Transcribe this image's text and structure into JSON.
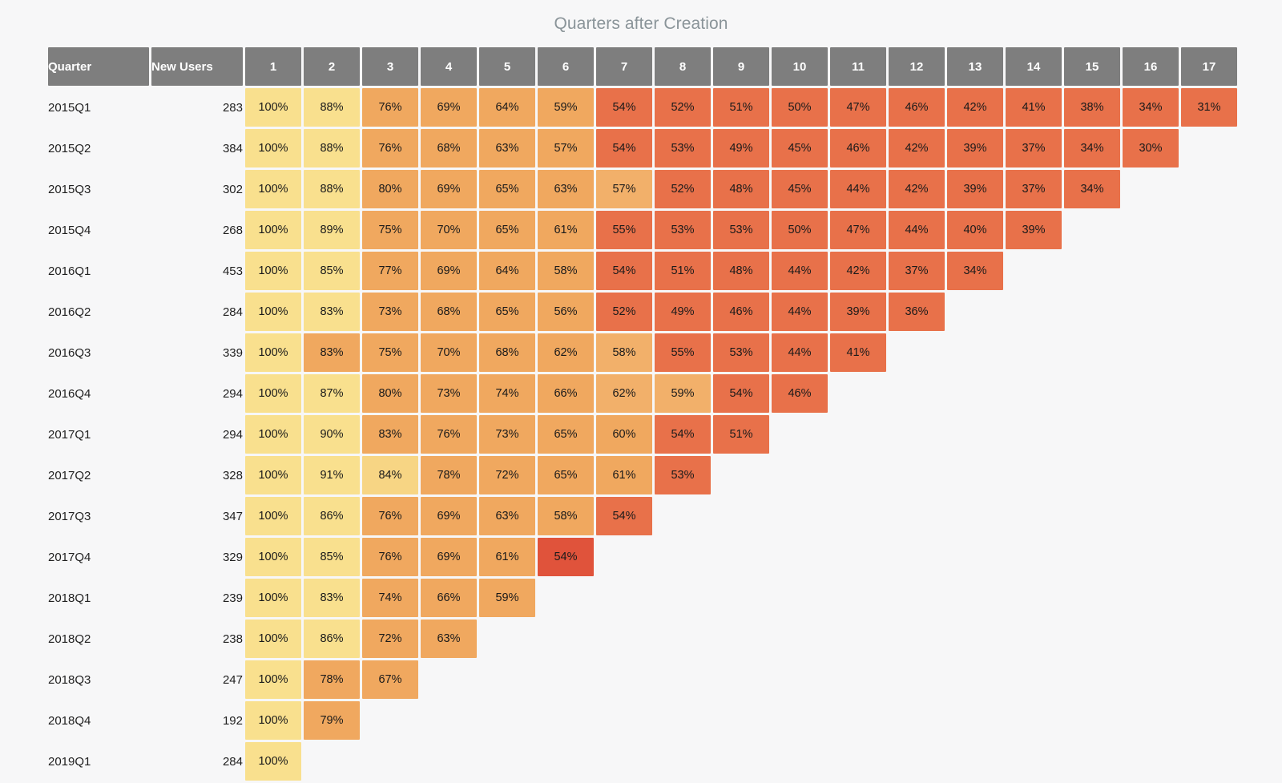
{
  "chart_data": {
    "type": "heatmap",
    "title": "Quarters after Creation",
    "xlabel": "",
    "ylabel": "",
    "row_header_labels": [
      "Quarter",
      "New Users"
    ],
    "categories": [
      "1",
      "2",
      "3",
      "4",
      "5",
      "6",
      "7",
      "8",
      "9",
      "10",
      "11",
      "12",
      "13",
      "14",
      "15",
      "16",
      "17"
    ],
    "grid": false,
    "legend": "none",
    "value_suffix": "%",
    "colorscale": {
      "name": "YlOrRd-binned",
      "bins": [
        {
          "max": 101,
          "color": "#f9e08e"
        },
        {
          "max": 93,
          "color": "#f9e08e"
        },
        {
          "max": 82,
          "color": "#f0a85f"
        },
        {
          "max": 56,
          "color": "#e8714a"
        },
        {
          "max": 0,
          "color": "#e05038"
        }
      ],
      "light": "#f9e08e",
      "mid": "#f0a85f",
      "dark": "#e8714a",
      "darkest": "#e0533b"
    },
    "header_bg": "#7e7e7e",
    "header_text": "#ffffff",
    "page_bg": "#f7f7f8",
    "title_color": "#8a9499",
    "rows": [
      {
        "quarter": "2015Q1",
        "new_users": "283",
        "values": [
          "100%",
          "88%",
          "76%",
          "69%",
          "64%",
          "59%",
          "54%",
          "52%",
          "51%",
          "50%",
          "47%",
          "46%",
          "42%",
          "41%",
          "38%",
          "34%",
          "31%"
        ],
        "colors": [
          "#f9e08e",
          "#f9e08e",
          "#f0a85f",
          "#f0a85f",
          "#f0a85f",
          "#f0a85f",
          "#e8714a",
          "#e8714a",
          "#e8714a",
          "#e8714a",
          "#e8714a",
          "#e8714a",
          "#e8714a",
          "#e8714a",
          "#e8714a",
          "#e8714a",
          "#e8714a"
        ]
      },
      {
        "quarter": "2015Q2",
        "new_users": "384",
        "values": [
          "100%",
          "88%",
          "76%",
          "68%",
          "63%",
          "57%",
          "54%",
          "53%",
          "49%",
          "45%",
          "46%",
          "42%",
          "39%",
          "37%",
          "34%",
          "30%"
        ],
        "colors": [
          "#f9e08e",
          "#f9e08e",
          "#f0a85f",
          "#f0a85f",
          "#f0a85f",
          "#f0a85f",
          "#e8714a",
          "#e8714a",
          "#e8714a",
          "#e8714a",
          "#e8714a",
          "#e8714a",
          "#e8714a",
          "#e8714a",
          "#e8714a",
          "#e8714a"
        ]
      },
      {
        "quarter": "2015Q3",
        "new_users": "302",
        "values": [
          "100%",
          "88%",
          "80%",
          "69%",
          "65%",
          "63%",
          "57%",
          "52%",
          "48%",
          "45%",
          "44%",
          "42%",
          "39%",
          "37%",
          "34%"
        ],
        "colors": [
          "#f9e08e",
          "#f9e08e",
          "#f0a85f",
          "#f0a85f",
          "#f0a85f",
          "#f0a85f",
          "#f2b06a",
          "#e8714a",
          "#e8714a",
          "#e8714a",
          "#e8714a",
          "#e8714a",
          "#e8714a",
          "#e8714a",
          "#e8714a"
        ]
      },
      {
        "quarter": "2015Q4",
        "new_users": "268",
        "values": [
          "100%",
          "89%",
          "75%",
          "70%",
          "65%",
          "61%",
          "55%",
          "53%",
          "53%",
          "50%",
          "47%",
          "44%",
          "40%",
          "39%"
        ],
        "colors": [
          "#f9e08e",
          "#f9e08e",
          "#f0a85f",
          "#f0a85f",
          "#f0a85f",
          "#f0a85f",
          "#e8714a",
          "#e8714a",
          "#e8714a",
          "#e8714a",
          "#e8714a",
          "#e8714a",
          "#e8714a",
          "#e8714a"
        ]
      },
      {
        "quarter": "2016Q1",
        "new_users": "453",
        "values": [
          "100%",
          "85%",
          "77%",
          "69%",
          "64%",
          "58%",
          "54%",
          "51%",
          "48%",
          "44%",
          "42%",
          "37%",
          "34%"
        ],
        "colors": [
          "#f9e08e",
          "#f9e08e",
          "#f0a85f",
          "#f0a85f",
          "#f0a85f",
          "#f0a85f",
          "#e8714a",
          "#e8714a",
          "#e8714a",
          "#e8714a",
          "#e8714a",
          "#e8714a",
          "#e8714a"
        ]
      },
      {
        "quarter": "2016Q2",
        "new_users": "284",
        "values": [
          "100%",
          "83%",
          "73%",
          "68%",
          "65%",
          "56%",
          "52%",
          "49%",
          "46%",
          "44%",
          "39%",
          "36%"
        ],
        "colors": [
          "#f9e08e",
          "#f9e08e",
          "#f0a85f",
          "#f0a85f",
          "#f0a85f",
          "#f0a85f",
          "#e8714a",
          "#e8714a",
          "#e8714a",
          "#e8714a",
          "#e8714a",
          "#e8714a"
        ]
      },
      {
        "quarter": "2016Q3",
        "new_users": "339",
        "values": [
          "100%",
          "83%",
          "75%",
          "70%",
          "68%",
          "62%",
          "58%",
          "55%",
          "53%",
          "44%",
          "41%"
        ],
        "colors": [
          "#f9e08e",
          "#f0a85f",
          "#f0a85f",
          "#f0a85f",
          "#f0a85f",
          "#f0a85f",
          "#f2b06a",
          "#e8714a",
          "#e8714a",
          "#e8714a",
          "#e8714a"
        ]
      },
      {
        "quarter": "2016Q4",
        "new_users": "294",
        "values": [
          "100%",
          "87%",
          "80%",
          "73%",
          "74%",
          "66%",
          "62%",
          "59%",
          "54%",
          "46%"
        ],
        "colors": [
          "#f9e08e",
          "#f9e08e",
          "#f0a85f",
          "#f0a85f",
          "#f0a85f",
          "#f0a85f",
          "#f2b06a",
          "#f2b06a",
          "#e8714a",
          "#e8714a"
        ]
      },
      {
        "quarter": "2017Q1",
        "new_users": "294",
        "values": [
          "100%",
          "90%",
          "83%",
          "76%",
          "73%",
          "65%",
          "60%",
          "54%",
          "51%"
        ],
        "colors": [
          "#f9e08e",
          "#f9e08e",
          "#f0a85f",
          "#f0a85f",
          "#f0a85f",
          "#f0a85f",
          "#f0a85f",
          "#e8714a",
          "#e8714a"
        ]
      },
      {
        "quarter": "2017Q2",
        "new_users": "328",
        "values": [
          "100%",
          "91%",
          "84%",
          "78%",
          "72%",
          "65%",
          "61%",
          "53%"
        ],
        "colors": [
          "#f9e08e",
          "#f9e08e",
          "#f7d584",
          "#f0a85f",
          "#f0a85f",
          "#f0a85f",
          "#f0a85f",
          "#e8714a"
        ]
      },
      {
        "quarter": "2017Q3",
        "new_users": "347",
        "values": [
          "100%",
          "86%",
          "76%",
          "69%",
          "63%",
          "58%",
          "54%"
        ],
        "colors": [
          "#f9e08e",
          "#f9e08e",
          "#f0a85f",
          "#f0a85f",
          "#f0a85f",
          "#f0a85f",
          "#e8714a"
        ]
      },
      {
        "quarter": "2017Q4",
        "new_users": "329",
        "values": [
          "100%",
          "85%",
          "76%",
          "69%",
          "61%",
          "54%"
        ],
        "colors": [
          "#f9e08e",
          "#f9e08e",
          "#f0a85f",
          "#f0a85f",
          "#f0a85f",
          "#e0533b"
        ]
      },
      {
        "quarter": "2018Q1",
        "new_users": "239",
        "values": [
          "100%",
          "83%",
          "74%",
          "66%",
          "59%"
        ],
        "colors": [
          "#f9e08e",
          "#f9e08e",
          "#f0a85f",
          "#f0a85f",
          "#f0a85f"
        ]
      },
      {
        "quarter": "2018Q2",
        "new_users": "238",
        "values": [
          "100%",
          "86%",
          "72%",
          "63%"
        ],
        "colors": [
          "#f9e08e",
          "#f9e08e",
          "#f0a85f",
          "#f0a85f"
        ]
      },
      {
        "quarter": "2018Q3",
        "new_users": "247",
        "values": [
          "100%",
          "78%",
          "67%"
        ],
        "colors": [
          "#f9e08e",
          "#f0a85f",
          "#f0a85f"
        ]
      },
      {
        "quarter": "2018Q4",
        "new_users": "192",
        "values": [
          "100%",
          "79%"
        ],
        "colors": [
          "#f9e08e",
          "#f0a85f"
        ]
      },
      {
        "quarter": "2019Q1",
        "new_users": "284",
        "values": [
          "100%"
        ],
        "colors": [
          "#f9e08e"
        ]
      }
    ]
  }
}
